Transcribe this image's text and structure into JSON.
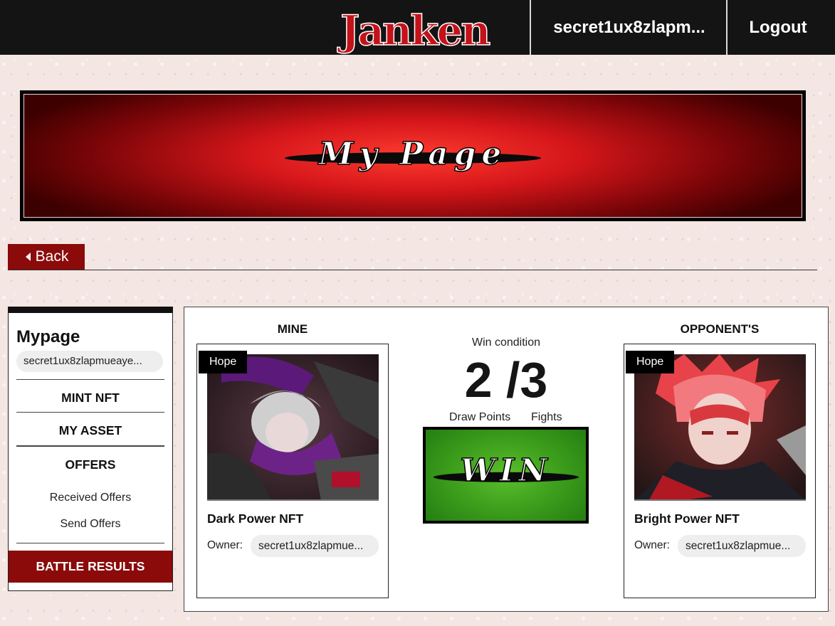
{
  "header": {
    "logo_text": "Janken",
    "account_label": "secret1ux8zlapm...",
    "logout_label": "Logout"
  },
  "banner": {
    "title": "My Page"
  },
  "back": {
    "label": "Back"
  },
  "sidebar": {
    "title": "Mypage",
    "address": "secret1ux8zlapmueaye...",
    "items": {
      "mint": "MINT NFT",
      "asset": "MY ASSET",
      "offers": "OFFERS",
      "received": "Received Offers",
      "sent": "Send Offers",
      "battle": "BATTLE RESULTS"
    }
  },
  "battle": {
    "mine_heading": "MINE",
    "opponent_heading": "OPPONENT'S",
    "win_condition_label": "Win condition",
    "score": "2 /3",
    "draw_points_label": "Draw Points",
    "fights_label": "Fights",
    "result": "WIN",
    "result_color": "#3fa01d",
    "mine_card": {
      "badge": "Hope",
      "name": "Dark Power NFT",
      "owner_label": "Owner:",
      "owner": "secret1ux8zlapmue..."
    },
    "opponent_card": {
      "badge": "Hope",
      "name": "Bright Power NFT",
      "owner_label": "Owner:",
      "owner": "secret1ux8zlapmue..."
    }
  },
  "colors": {
    "header_bg": "#141414",
    "accent": "#8b0a0a",
    "banner_red": "#d5161a",
    "page_bg": "#f3e6e3"
  }
}
